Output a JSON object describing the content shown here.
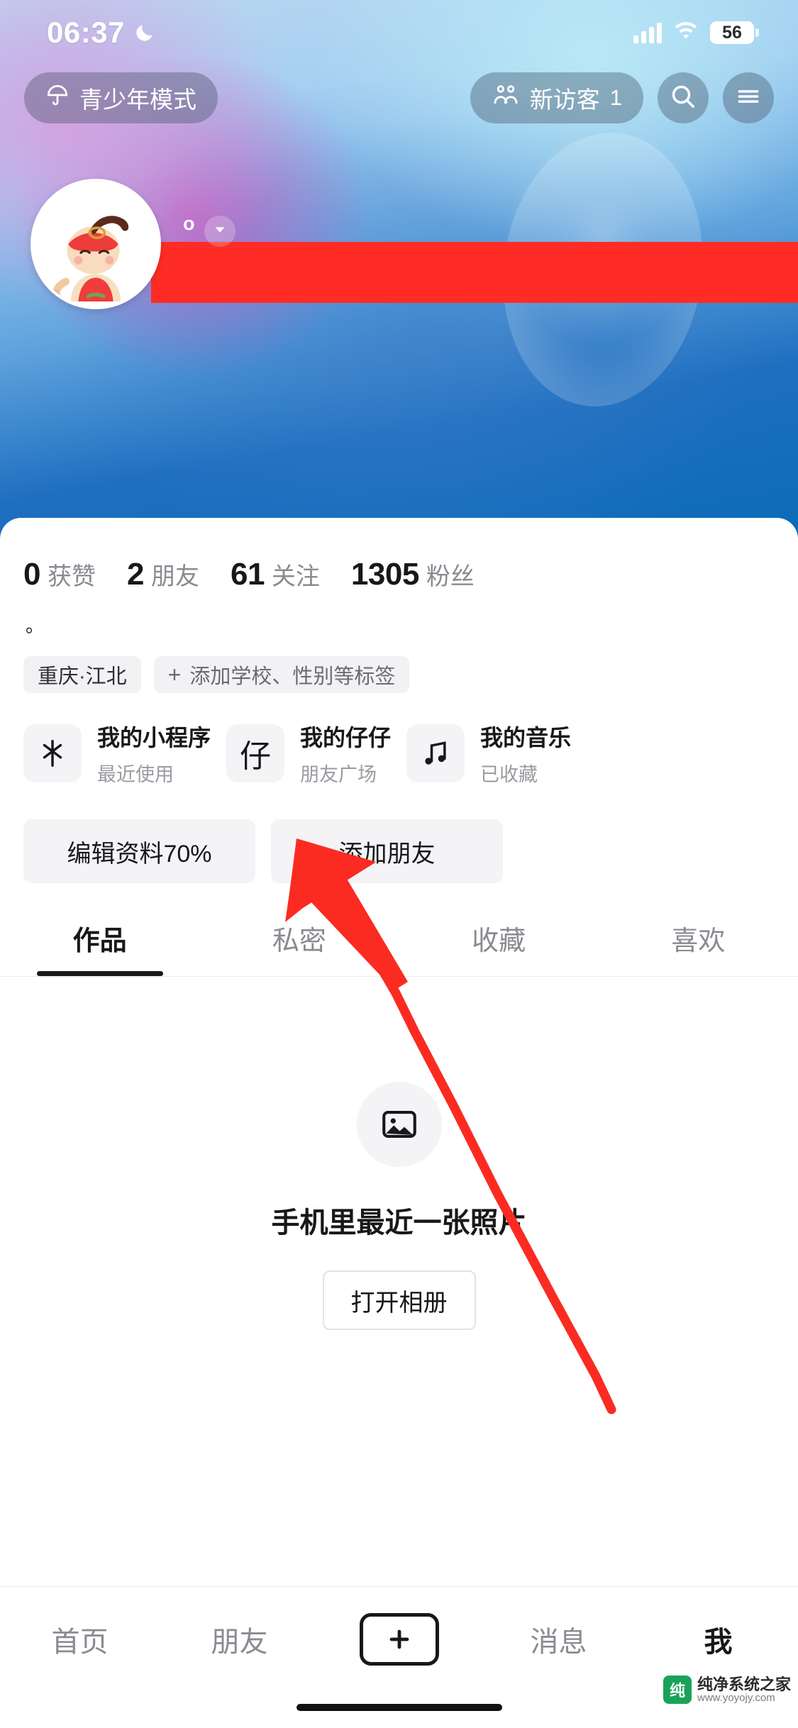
{
  "status_bar": {
    "time": "06:37",
    "moon_icon": "crescent-moon-icon",
    "signal_icon": "cellular-signal-icon",
    "wifi_icon": "wifi-icon",
    "battery_level": "56"
  },
  "toolbar": {
    "teen_mode_label": "青少年模式",
    "teen_mode_icon": "umbrella-icon",
    "visitor_label": "新访客",
    "visitor_count": "1",
    "visitor_icon": "two-people-icon",
    "search_icon": "search-icon",
    "menu_icon": "hamburger-menu-icon"
  },
  "profile": {
    "avatar_icon": "cartoon-avatar",
    "douyin_id_prefix": "o",
    "dropdown_icon": "chevron-down-icon",
    "name_redacted": true,
    "bio": "。",
    "stats": [
      {
        "num": "0",
        "label": "获赞"
      },
      {
        "num": "2",
        "label": "朋友"
      },
      {
        "num": "61",
        "label": "关注"
      },
      {
        "num": "1305",
        "label": "粉丝"
      }
    ],
    "tags": [
      {
        "text": "重庆·江北",
        "has_plus": false
      },
      {
        "text": "添加学校、性别等标签",
        "has_plus": true,
        "plus": "+"
      }
    ]
  },
  "shortcut_cards": [
    {
      "icon": "mini-program-icon",
      "title": "我的小程序",
      "subtitle": "最近使用"
    },
    {
      "icon": "zaizai-icon",
      "title": "我的仔仔",
      "subtitle": "朋友广场",
      "glyph": "仔"
    },
    {
      "icon": "music-note-icon",
      "title": "我的音乐",
      "subtitle": "已收藏"
    }
  ],
  "actions": {
    "edit_profile_label": "编辑资料70%",
    "add_friend_label": "添加朋友"
  },
  "tabs": [
    {
      "label": "作品",
      "active": true
    },
    {
      "label": "私密",
      "active": false
    },
    {
      "label": "收藏",
      "active": false
    },
    {
      "label": "喜欢",
      "active": false
    }
  ],
  "empty_state": {
    "icon": "photo-placeholder-icon",
    "title": "手机里最近一张照片",
    "button_label": "打开相册"
  },
  "bottom_nav": [
    {
      "label": "首页",
      "active": false
    },
    {
      "label": "朋友",
      "active": false
    },
    {
      "label": "+",
      "active": false,
      "is_plus": true
    },
    {
      "label": "消息",
      "active": false
    },
    {
      "label": "我",
      "active": true
    }
  ],
  "annotation": {
    "arrow_color": "#fb2b21",
    "points_at": "编辑资料70%"
  },
  "watermark": {
    "title": "纯净系统之家",
    "url": "www.yoyojy.com",
    "logo_letter": "纯"
  },
  "colors": {
    "accent_red": "#fe2c24",
    "cover_blue": "#0b6bb8",
    "text_primary": "#17181a",
    "text_secondary": "#8a8b91",
    "chip_bg": "#f2f2f4"
  }
}
